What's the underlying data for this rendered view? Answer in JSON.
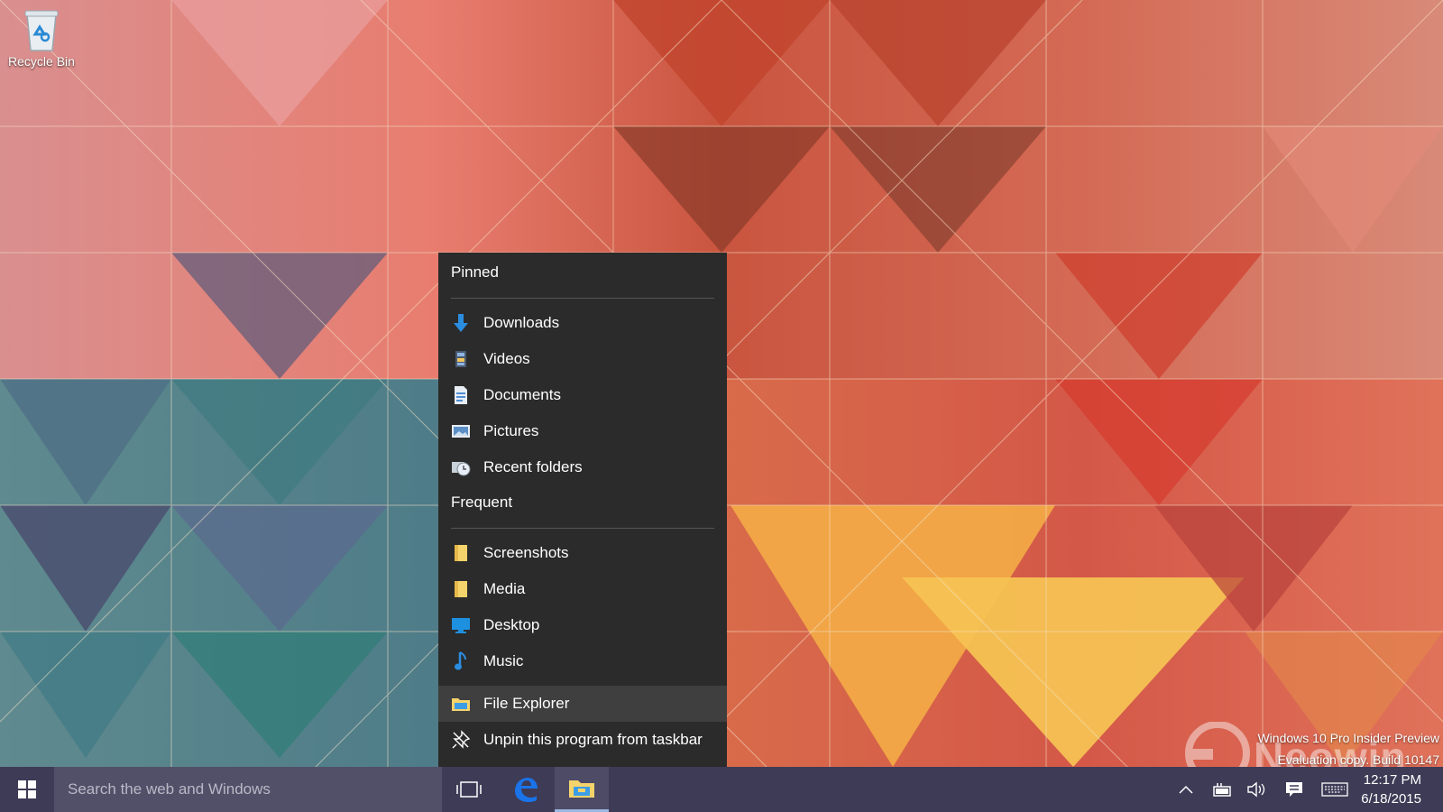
{
  "desktop": {
    "recycle_bin_label": "Recycle Bin"
  },
  "watermark": {
    "line1": "Windows 10 Pro Insider Preview",
    "line2": "Evaluation copy. Build 10147",
    "logo_text": "Neowin"
  },
  "jumplist": {
    "pinned_title": "Pinned",
    "pinned": [
      {
        "label": "Downloads",
        "icon": "download-arrow-icon"
      },
      {
        "label": "Videos",
        "icon": "videos-folder-icon"
      },
      {
        "label": "Documents",
        "icon": "documents-folder-icon"
      },
      {
        "label": "Pictures",
        "icon": "pictures-folder-icon"
      },
      {
        "label": "Recent folders",
        "icon": "recent-folders-icon"
      }
    ],
    "frequent_title": "Frequent",
    "frequent": [
      {
        "label": "Screenshots",
        "icon": "folder-icon"
      },
      {
        "label": "Media",
        "icon": "folder-icon"
      },
      {
        "label": "Desktop",
        "icon": "desktop-icon"
      },
      {
        "label": "Music",
        "icon": "music-note-icon"
      }
    ],
    "tasks": [
      {
        "label": "File Explorer",
        "icon": "file-explorer-icon"
      },
      {
        "label": "Unpin this program from taskbar",
        "icon": "unpin-icon"
      }
    ]
  },
  "taskbar": {
    "search_placeholder": "Search the web and Windows",
    "apps": [
      {
        "name": "Task View",
        "icon": "task-view-icon"
      },
      {
        "name": "Microsoft Edge",
        "icon": "edge-icon"
      },
      {
        "name": "File Explorer",
        "icon": "file-explorer-icon",
        "active": true
      }
    ],
    "clock": {
      "time": "12:17 PM",
      "date": "6/18/2015"
    }
  },
  "colors": {
    "taskbar": "#3e3b56",
    "search_box": "#525068",
    "jumplist_bg": "#2b2b2b",
    "accent_blue": "#1e90ff",
    "folder_yellow": "#f5d36b"
  }
}
